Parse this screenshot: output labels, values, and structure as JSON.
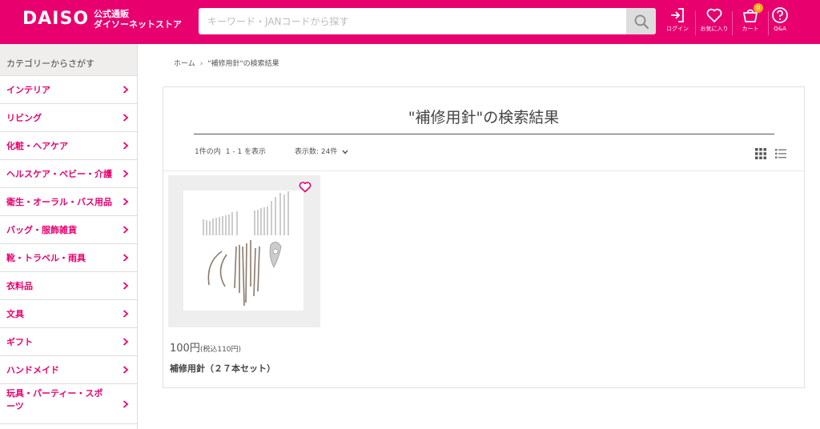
{
  "colors": {
    "brand": "#e8006f",
    "badge": "#f7a723"
  },
  "header": {
    "logo_text": "DAISO",
    "logo_sub_line1": "公式通販",
    "logo_sub_line2": "ダイソーネットストア",
    "search_placeholder": "キーワード・JANコードから探す",
    "search_icon": "magnifier-icon",
    "actions": [
      {
        "label": "ログイン",
        "icon": "login-icon"
      },
      {
        "label": "お気に入り",
        "icon": "heart-icon"
      },
      {
        "label": "カート",
        "icon": "cart-icon",
        "badge": "0"
      },
      {
        "label": "Q&A",
        "icon": "question-icon"
      }
    ]
  },
  "sidebar": {
    "heading": "カテゴリーからさがす",
    "items": [
      {
        "label": "インテリア"
      },
      {
        "label": "リビング"
      },
      {
        "label": "化粧・ヘアケア"
      },
      {
        "label": "ヘルスケア・ベビー・介護"
      },
      {
        "label": "衛生・オーラル・バス用品"
      },
      {
        "label": "バッグ・服飾雑貨"
      },
      {
        "label": "靴・トラベル・雨具"
      },
      {
        "label": "衣料品"
      },
      {
        "label": "文具"
      },
      {
        "label": "ギフト"
      },
      {
        "label": "ハンドメイド"
      },
      {
        "label": "玩具・パーティー・スポーツ"
      }
    ]
  },
  "breadcrumb": {
    "home": "ホーム",
    "separator": "›",
    "current": "\"補修用針\"の検索結果"
  },
  "results": {
    "title": "\"補修用針\"の検索結果",
    "count_total": "1件の内",
    "count_range": "1 - 1 を表示",
    "per_page_label": "表示数: 24件",
    "view_grid_icon": "grid-view-icon",
    "view_list_icon": "list-view-icon"
  },
  "products": [
    {
      "name": "補修用針（２７本セット）",
      "price": "100円",
      "price_tax": "(税込110円)"
    }
  ]
}
